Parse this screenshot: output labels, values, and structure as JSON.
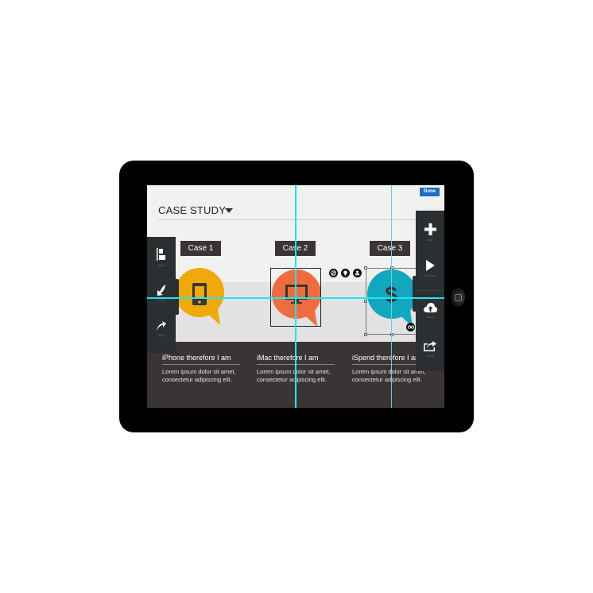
{
  "device": {
    "type": "tablet",
    "home_button": "home-button-icon"
  },
  "header": {
    "title": "CASE STUDY",
    "title_dropdown_icon": "caret-down-icon",
    "done_label": "Done"
  },
  "colors": {
    "accent_blue": "#1a6fc1",
    "guide_cyan": "#1fe6ef",
    "case1_bubble": "#f0a90a",
    "case2_bubble": "#ee6c3f",
    "case3_bubble": "#12a7bf",
    "dark_panel": "#3b3434",
    "toolbar": "#2b2f31"
  },
  "left_toolbar": [
    {
      "icon": "align-icon",
      "label": "Align"
    },
    {
      "icon": "undo-icon",
      "label": "Undo"
    },
    {
      "icon": "redo-icon",
      "label": "Redo"
    }
  ],
  "right_toolbar": [
    {
      "icon": "plus-icon",
      "label": "Add"
    },
    {
      "icon": "play-icon",
      "label": "Preview"
    },
    {
      "icon": "cloud-upload-icon",
      "label": "Save"
    },
    {
      "icon": "share-icon",
      "label": "Share"
    }
  ],
  "cases": [
    {
      "tag": "Case 1",
      "icon": "smartphone-icon",
      "title": "iPhone therefore I am",
      "body": "Lorem ipsum dolor sit amet, consectetur adipiscing elit."
    },
    {
      "tag": "Case 2",
      "icon": "monitor-icon",
      "title": "iMac therefore I am",
      "body": "Lorem ipsum dolor sit amet, consectetur adipiscing elit."
    },
    {
      "tag": "Case 3",
      "icon": "dollar-icon",
      "title": "iSpend therefore I am",
      "body": "Lorem ipsum dolor sit amet, consectetur adipiscing elit."
    }
  ],
  "selection_controls": [
    {
      "icon": "disable-icon"
    },
    {
      "icon": "lightbulb-icon"
    },
    {
      "icon": "stamp-icon"
    }
  ],
  "link_control": {
    "icon": "link-icon"
  }
}
